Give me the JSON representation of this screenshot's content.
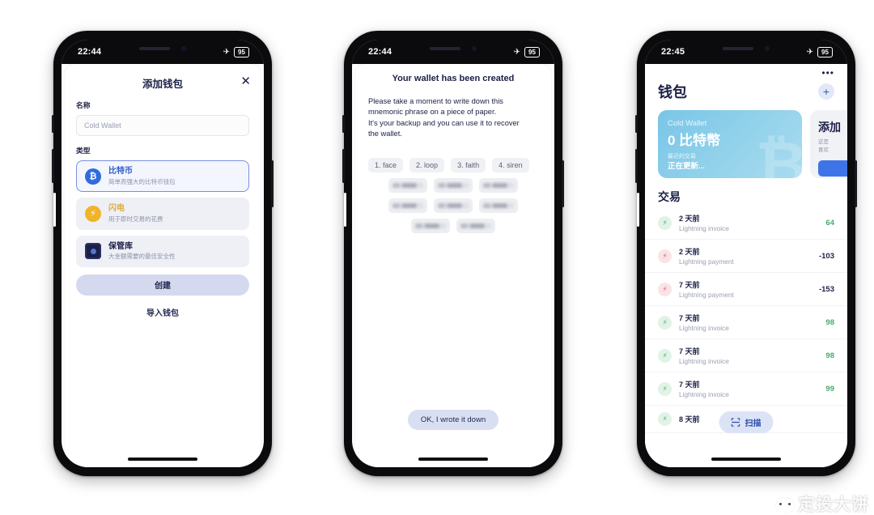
{
  "phone1": {
    "status": {
      "time": "22:44",
      "airplane_icon": "airplane-icon",
      "battery": "95"
    },
    "header": {
      "title": "添加钱包",
      "close_icon": "✕"
    },
    "form": {
      "name_label": "名称",
      "name_placeholder": "Cold Wallet",
      "type_label": "类型"
    },
    "options": [
      {
        "icon": "bitcoin-icon",
        "glyph": "₿",
        "title": "比特币",
        "desc": "简单而强大的比特币钱包",
        "selected": true
      },
      {
        "icon": "lightning-icon",
        "glyph": "⚡",
        "title": "闪电",
        "desc": "用于即时交易的花费",
        "selected": false
      },
      {
        "icon": "vault-icon",
        "glyph": "",
        "title": "保管库",
        "desc": "大金额需要的最佳安全性",
        "selected": false
      }
    ],
    "create_button": "创建",
    "import_link": "导入钱包"
  },
  "phone2": {
    "status": {
      "time": "22:44",
      "airplane_icon": "airplane-icon",
      "battery": "95"
    },
    "title": "Your wallet has been created",
    "paragraph": "Please take a moment to write down this mnemonic phrase on a piece of paper.\nIt's your backup and you can use it to recover the wallet.",
    "words_visible": [
      "1. face",
      "2. loop",
      "3. faith",
      "4. siren"
    ],
    "words_hidden_rows": [
      3,
      3,
      2
    ],
    "confirm_button": "OK, I wrote it down"
  },
  "phone3": {
    "status": {
      "time": "22:45",
      "airplane_icon": "airplane-icon",
      "battery": "95"
    },
    "more_icon": "•••",
    "page_title": "钱包",
    "add_icon": "+",
    "wallet_card": {
      "name": "Cold Wallet",
      "balance": "0 比特幣",
      "recent_label": "最近的交易",
      "recent_status": "正在更新...",
      "symbol": "₿"
    },
    "add_card": {
      "title": "添加",
      "desc": "这是\n喜欢",
      "button": ""
    },
    "transactions_title": "交易",
    "transactions": [
      {
        "icon": "lightning-in-icon",
        "direction": "in",
        "date": "2 天前",
        "type": "Lightning invoice",
        "amount": "64"
      },
      {
        "icon": "lightning-out-icon",
        "direction": "out",
        "date": "2 天前",
        "type": "Lightning payment",
        "amount": "-103"
      },
      {
        "icon": "lightning-out-icon",
        "direction": "out",
        "date": "7 天前",
        "type": "Lightning payment",
        "amount": "-153"
      },
      {
        "icon": "lightning-in-icon",
        "direction": "in",
        "date": "7 天前",
        "type": "Lightning invoice",
        "amount": "98"
      },
      {
        "icon": "lightning-in-icon",
        "direction": "in",
        "date": "7 天前",
        "type": "Lightning invoice",
        "amount": "98"
      },
      {
        "icon": "lightning-in-icon",
        "direction": "in",
        "date": "7 天前",
        "type": "Lightning invoice",
        "amount": "99"
      },
      {
        "icon": "lightning-in-icon",
        "direction": "in",
        "date": "8 天前",
        "type": "",
        "amount": ""
      }
    ],
    "scan_button": {
      "icon": "scan-icon",
      "label": "扫描"
    }
  },
  "watermark": {
    "icon": "wechat-icon",
    "text": "定投大饼"
  }
}
